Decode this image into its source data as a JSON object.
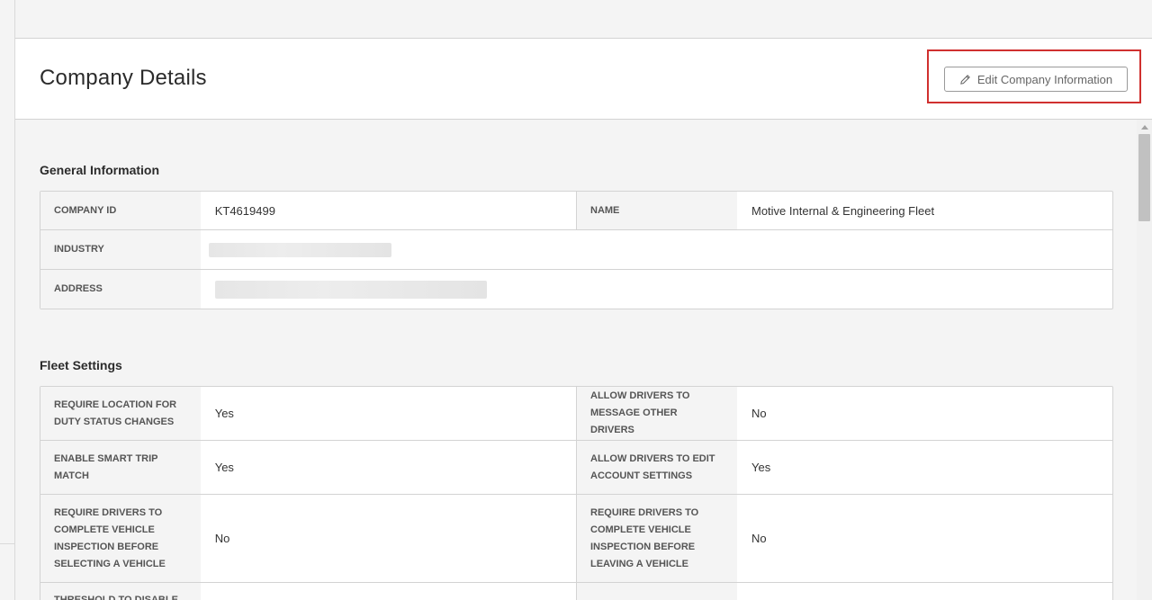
{
  "header": {
    "title": "Company Details",
    "edit_button_label": "Edit Company Information"
  },
  "general": {
    "section_title": "General Information",
    "company_id_label": "COMPANY ID",
    "company_id_value": "KT4619499",
    "name_label": "NAME",
    "name_value": "Motive Internal & Engineering Fleet",
    "industry_label": "INDUSTRY",
    "address_label": "ADDRESS"
  },
  "fleet": {
    "section_title": "Fleet Settings",
    "rows": [
      {
        "left_label": "REQUIRE LOCATION FOR DUTY STATUS CHANGES",
        "left_value": "Yes",
        "right_label": "ALLOW DRIVERS TO MESSAGE OTHER DRIVERS",
        "right_value": "No"
      },
      {
        "left_label": "ENABLE SMART TRIP MATCH",
        "left_value": "Yes",
        "right_label": "ALLOW DRIVERS TO EDIT ACCOUNT SETTINGS",
        "right_value": "Yes"
      },
      {
        "left_label": "REQUIRE DRIVERS TO COMPLETE VEHICLE INSPECTION BEFORE SELECTING A VEHICLE",
        "left_value": "No",
        "right_label": "REQUIRE DRIVERS TO COMPLETE VEHICLE INSPECTION BEFORE LEAVING A VEHICLE",
        "right_value": "No"
      },
      {
        "left_label": "THRESHOLD TO DISABLE",
        "left_value": "",
        "right_label": "",
        "right_value": ""
      }
    ]
  },
  "icons": {
    "edit": "pencil-icon"
  },
  "colors": {
    "highlight": "#d0302f",
    "label_bg": "#f4f4f4",
    "border": "#d3d3d3"
  }
}
